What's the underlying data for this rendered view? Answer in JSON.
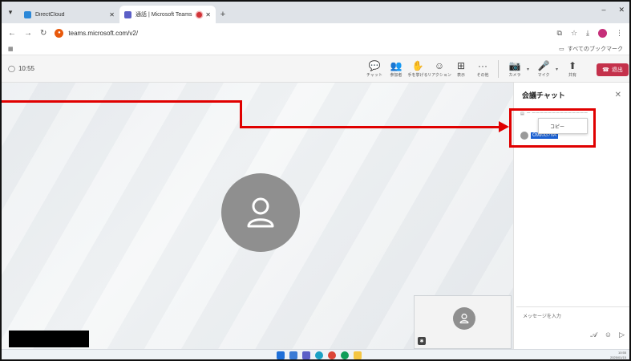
{
  "browser": {
    "tabs": [
      {
        "label": "DirectCloud",
        "favicon_color": "#2b88d8",
        "active": false
      },
      {
        "label": "通話 | Microsoft Teams",
        "favicon_color": "#5b5fc7",
        "active": true
      }
    ],
    "new_tab": "+",
    "url": "teams.microsoft.com/v2/",
    "bookmarks_right": "すべてのブックマーク"
  },
  "teams": {
    "timer": "10:55",
    "tools": [
      {
        "icon": "chat-icon",
        "glyph": "💬",
        "label": "チャット"
      },
      {
        "icon": "people-icon",
        "glyph": "👥",
        "label": "参加者"
      },
      {
        "icon": "hand-icon",
        "glyph": "✋",
        "label": "手を挙げる"
      },
      {
        "icon": "reaction-icon",
        "glyph": "☺",
        "label": "リアクション"
      },
      {
        "icon": "view-icon",
        "glyph": "⊞",
        "label": "表示"
      },
      {
        "icon": "more-icon",
        "glyph": "···",
        "label": "その他"
      }
    ],
    "devices": [
      {
        "icon": "camera-icon",
        "glyph": "📷",
        "label": "カメラ"
      },
      {
        "icon": "mic-icon",
        "glyph": "🎤",
        "label": "マイク"
      },
      {
        "icon": "share-icon",
        "glyph": "⬆",
        "label": "共有"
      }
    ],
    "leave_label": "退出",
    "accent": "#c4314b"
  },
  "chat": {
    "title": "会議チャット",
    "system_message": "ー ーーーーーーーーーーーーーー",
    "selected_message": "O9d0G7hA",
    "context_menu_item": "コピー",
    "input_placeholder": "メッセージを入力",
    "send_icons": [
      "format-icon",
      "emoji-icon",
      "send-icon"
    ]
  },
  "taskbar": {
    "time": "10:55",
    "date": "2025/01/15"
  },
  "annotation_color": "#e00000"
}
